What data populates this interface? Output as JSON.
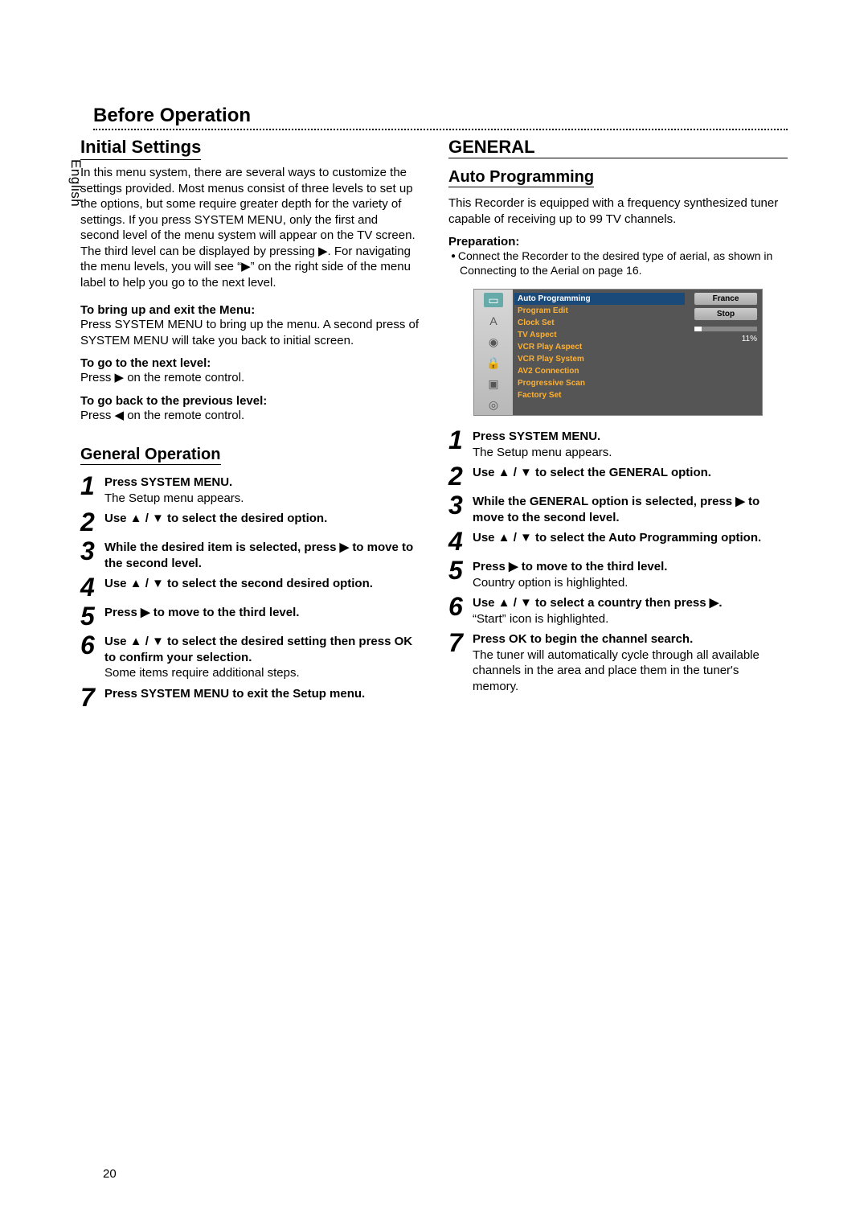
{
  "header": {
    "before_operation": "Before Operation",
    "language_tab": "English"
  },
  "left": {
    "initial_settings": "Initial Settings",
    "intro": "In this menu system, there are several ways to customize the settings provided. Most menus consist of three levels to set up the options, but some require greater depth for the variety of settings. If you press SYSTEM MENU, only the first and second level of the menu system will appear on the TV screen. The third level can be displayed by pressing ▶. For navigating the menu levels, you will see “▶” on the right side of the menu label to help you go to the next level.",
    "bring_up_heading": "To bring up and exit the Menu:",
    "bring_up_text": "Press SYSTEM MENU to bring up the menu. A second press of SYSTEM MENU will take you back to initial screen.",
    "next_level_heading": "To go to the next level:",
    "next_level_text": "Press ▶ on the remote control.",
    "prev_level_heading": "To go back to the previous level:",
    "prev_level_text": "Press ◀ on the remote control.",
    "general_operation": "General Operation",
    "steps": [
      {
        "n": "1",
        "bold": "Press SYSTEM MENU.",
        "rest": "The Setup menu appears."
      },
      {
        "n": "2",
        "bold": "Use ▲ / ▼ to select the desired option.",
        "rest": ""
      },
      {
        "n": "3",
        "bold": "While the desired item is selected, press ▶ to move to the second level.",
        "rest": ""
      },
      {
        "n": "4",
        "bold": "Use ▲ / ▼ to select the second desired option.",
        "rest": ""
      },
      {
        "n": "5",
        "bold": "Press ▶ to move to the third level.",
        "rest": ""
      },
      {
        "n": "6",
        "bold": "Use ▲ / ▼ to select the desired setting then press OK to confirm your selection.",
        "rest": "Some items require additional steps."
      },
      {
        "n": "7",
        "bold": "Press SYSTEM MENU to exit the Setup menu.",
        "rest": ""
      }
    ]
  },
  "right": {
    "general": "GENERAL",
    "auto_programming": "Auto Programming",
    "autoprog_intro": "This Recorder is equipped with a frequency synthesized tuner capable of receiving up to 99 TV channels.",
    "preparation_label": "Preparation:",
    "preparation_item": "Connect the Recorder to the desired type of aerial, as shown in Connecting to the Aerial on page 16.",
    "osd": {
      "items": [
        "Auto Programming",
        "Program Edit",
        "Clock Set",
        "TV Aspect",
        "VCR Play Aspect",
        "VCR Play System",
        "AV2 Connection",
        "Progressive Scan",
        "Factory Set"
      ],
      "btn1": "France",
      "btn2": "Stop",
      "percent": "11%"
    },
    "steps": [
      {
        "n": "1",
        "bold": "Press SYSTEM MENU.",
        "rest": "The Setup menu appears."
      },
      {
        "n": "2",
        "bold": "Use ▲ / ▼ to select the GENERAL option.",
        "rest": ""
      },
      {
        "n": "3",
        "bold": "While the GENERAL option is selected, press ▶ to move to the second level.",
        "rest": ""
      },
      {
        "n": "4",
        "bold": "Use ▲ / ▼ to select the Auto Programming option.",
        "rest": ""
      },
      {
        "n": "5",
        "bold": "Press ▶ to move to the third level.",
        "rest": "Country option is highlighted."
      },
      {
        "n": "6",
        "bold": "Use ▲ / ▼ to select a country then press ▶.",
        "rest": "“Start” icon is highlighted."
      },
      {
        "n": "7",
        "bold": "Press OK to begin the channel search.",
        "rest": "The tuner will automatically cycle through all available channels in the area and place them in the tuner's memory."
      }
    ]
  },
  "page_number": "20"
}
